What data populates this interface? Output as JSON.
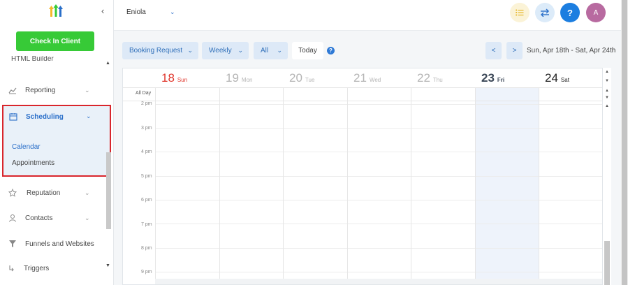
{
  "sidebar": {
    "checkin_label": "Check In Client",
    "cut_item_label": "HTML Builder",
    "items": [
      {
        "label": "Reporting",
        "icon": "chart-icon"
      },
      {
        "label": "Reputation",
        "icon": "star-icon"
      },
      {
        "label": "Contacts",
        "icon": "user-icon"
      },
      {
        "label": "Funnels and Websites",
        "icon": "funnel-icon"
      },
      {
        "label": "Triggers",
        "icon": "trigger-icon"
      }
    ],
    "scheduling": {
      "label": "Scheduling",
      "icon": "calendar-icon",
      "sub_items": [
        "Calendar",
        "Appointments"
      ]
    }
  },
  "topbar": {
    "location": "Eniola",
    "avatar_initial": "A",
    "help_label": "?"
  },
  "toolbar": {
    "filter_type": "Booking Request",
    "view": "Weekly",
    "calendar_filter": "All",
    "today_label": "Today",
    "help_label": "?",
    "prev_label": "<",
    "next_label": ">",
    "range_label": "Sun, Apr 18th - Sat, Apr 24th"
  },
  "calendar": {
    "all_day_label": "All Day",
    "days": [
      {
        "num": "18",
        "name": "Sun",
        "state": "sunday"
      },
      {
        "num": "19",
        "name": "Mon",
        "state": "past"
      },
      {
        "num": "20",
        "name": "Tue",
        "state": "past"
      },
      {
        "num": "21",
        "name": "Wed",
        "state": "past"
      },
      {
        "num": "22",
        "name": "Thu",
        "state": "past"
      },
      {
        "num": "23",
        "name": "Fri",
        "state": "today"
      },
      {
        "num": "24",
        "name": "Sat",
        "state": "future"
      }
    ],
    "times": [
      "2 pm",
      "3 pm",
      "4 pm",
      "5 pm",
      "6 pm",
      "7 pm",
      "8 pm",
      "9 pm"
    ]
  },
  "colors": {
    "primary": "#2a6fc9",
    "checkin": "#37ca37",
    "highlight": "#d9262c",
    "sunday": "#e0352b",
    "today_text": "#3b4757",
    "future_text": "#222222",
    "past_text": "#b5b5b5"
  }
}
